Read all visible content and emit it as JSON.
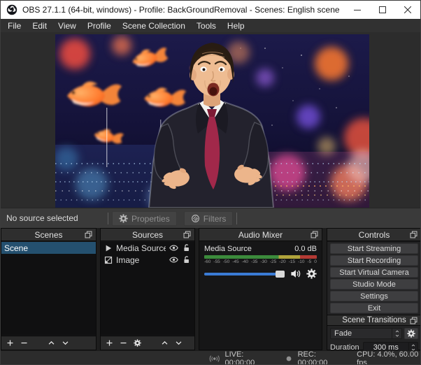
{
  "window": {
    "title": "OBS 27.1.1 (64-bit, windows) - Profile: BackGroundRemoval - Scenes: English scene"
  },
  "menu": {
    "items": [
      "File",
      "Edit",
      "View",
      "Profile",
      "Scene Collection",
      "Tools",
      "Help"
    ]
  },
  "source_toolbar": {
    "status": "No source selected",
    "properties_label": "Properties",
    "filters_label": "Filters"
  },
  "scenes": {
    "title": "Scenes",
    "items": [
      {
        "name": "Scene",
        "selected": true
      }
    ]
  },
  "sources": {
    "title": "Sources",
    "items": [
      {
        "name": "Media Source",
        "icon": "play-icon",
        "visible": true,
        "locked": false
      },
      {
        "name": "Image",
        "icon": "image-icon",
        "visible": true,
        "locked": false
      }
    ]
  },
  "mixer": {
    "title": "Audio Mixer",
    "channel": {
      "name": "Media Source",
      "level": "0.0 dB",
      "volume_percent": 90,
      "ticks": [
        "-60",
        "-55",
        "-50",
        "-45",
        "-40",
        "-35",
        "-30",
        "-25",
        "-20",
        "-15",
        "-10",
        "-5",
        "0"
      ]
    }
  },
  "controls": {
    "title": "Controls",
    "buttons": [
      "Start Streaming",
      "Start Recording",
      "Start Virtual Camera",
      "Studio Mode",
      "Settings",
      "Exit"
    ]
  },
  "transitions": {
    "title": "Scene Transitions",
    "selected_transition": "Fade",
    "duration_label": "Duration",
    "duration_value": "300 ms"
  },
  "statusbar": {
    "live": "LIVE: 00:00:00",
    "rec": "REC: 00:00:00",
    "stats": "CPU: 4.0%, 60.00 fps"
  },
  "icons": {
    "titlebar": "obs-logo-icon",
    "properties": "gear-icon",
    "filters": "filter-icon",
    "dock_header": "pin-icon",
    "media_source": "play-icon",
    "image": "image-icon",
    "visibility": "eye-icon",
    "lock": "lock-open-icon",
    "mixer_volume": "speaker-icon",
    "mixer_settings": "gear-icon",
    "live": "broadcast-icon",
    "rec": "record-dot-icon"
  },
  "colors": {
    "titlebar_bg": "#ffffff",
    "accent_blue": "#3a7bd5",
    "selected_row": "#24506f",
    "meter_green": "#3c8b3c",
    "meter_yellow": "#b0a43c",
    "meter_red": "#b33a34"
  }
}
